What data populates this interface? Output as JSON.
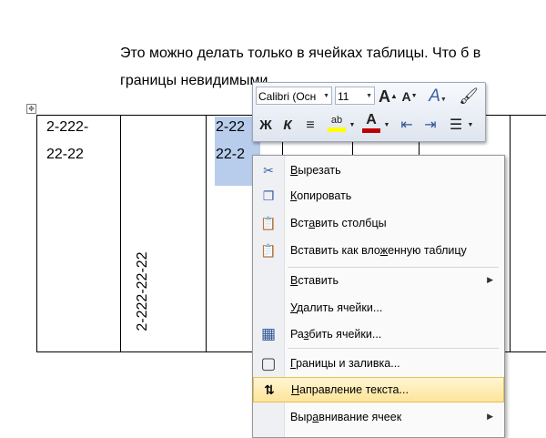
{
  "document": {
    "line1": "Это можно делать только в ячейках таблицы. Что б в",
    "line2": "границы невидимыми",
    "table_move_glyph": "✥",
    "cells": {
      "c1_line1": "2-222-",
      "c1_line2": "22-22",
      "c2_vertical": "2-222-22-22",
      "c3_line1": "2-22",
      "c3_line2": "22-2"
    }
  },
  "mini_toolbar": {
    "font_name": "Calibri (Осн",
    "font_size": "11",
    "grow_font": "A",
    "shrink_font": "A",
    "bold": "Ж",
    "italic": "К",
    "highlight": "ab",
    "font_color": "A",
    "icons": [
      "grow-font-icon",
      "shrink-font-icon",
      "styles-icon",
      "format-painter-icon",
      "bold-icon",
      "italic-icon",
      "center-align-icon",
      "highlight-icon",
      "font-color-icon",
      "decrease-indent-icon",
      "increase-indent-icon",
      "bullets-icon"
    ],
    "highlight_color": "#ffff00",
    "font_color_value": "#c00000"
  },
  "context_menu": {
    "items": [
      {
        "u": "В",
        "rest": "ырезать",
        "icon": "cut-icon",
        "glyph": "✂"
      },
      {
        "u": "К",
        "rest": "опировать",
        "icon": "copy-icon",
        "glyph": "❐"
      },
      {
        "pre": "Вст",
        "u": "а",
        "rest": "вить столбцы",
        "icon": "paste-columns-icon",
        "glyph": "📋"
      },
      {
        "pre": "Вставить как вло",
        "u": "ж",
        "rest": "енную таблицу",
        "icon": "paste-nested-table-icon",
        "glyph": "📋"
      },
      {
        "u": "В",
        "rest": "ставить",
        "icon": "",
        "submenu": true
      },
      {
        "pre": "",
        "u": "У",
        "rest": "далить ячейки...",
        "icon": ""
      },
      {
        "pre": "Ра",
        "u": "з",
        "rest": "бить ячейки...",
        "icon": "split-cells-icon",
        "glyph": "▦"
      },
      {
        "u": "Г",
        "rest": "раницы и заливка...",
        "icon": "borders-icon",
        "glyph": "▢"
      },
      {
        "u": "Н",
        "rest": "аправление текста...",
        "icon": "text-direction-icon",
        "glyph": "⇅"
      },
      {
        "pre": "Выр",
        "u": "а",
        "rest": "внивание ячеек",
        "icon": "",
        "submenu": true
      }
    ],
    "submenu_glyph": "▶",
    "highlight_bg": "#fde49a"
  }
}
